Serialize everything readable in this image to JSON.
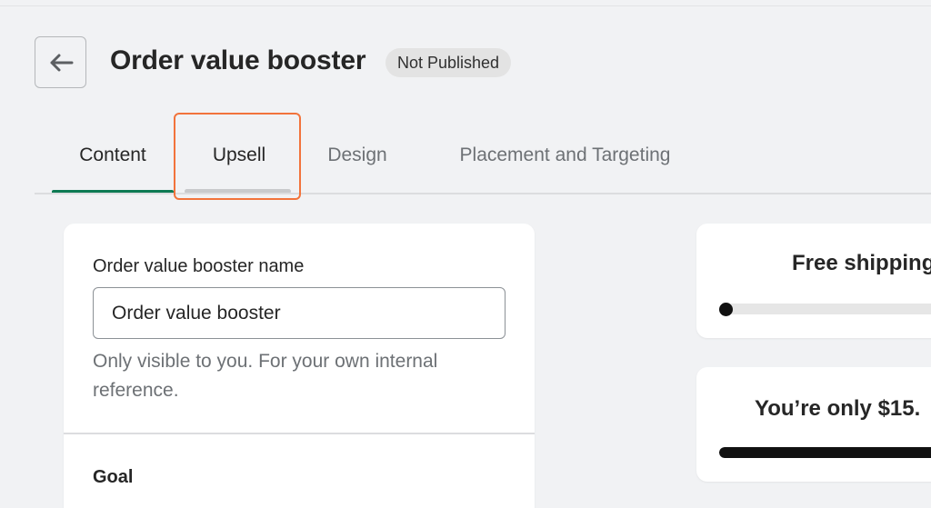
{
  "header": {
    "title": "Order value booster",
    "status_badge": "Not Published"
  },
  "tabs": [
    {
      "label": "Content",
      "active": true
    },
    {
      "label": "Upsell",
      "active": false,
      "highlighted": true
    },
    {
      "label": "Design",
      "active": false
    },
    {
      "label": "Placement and Targeting",
      "active": false
    }
  ],
  "form": {
    "name_label": "Order value booster name",
    "name_value": "Order value booster",
    "name_help": "Only visible to you. For your own internal reference.",
    "goal_title": "Goal"
  },
  "preview": {
    "card1_heading": "Free shipping",
    "card1_progress": 0.0,
    "card2_heading": "You’re only $15.",
    "card2_progress": 1.0
  },
  "colors": {
    "accent_green": "#0e7a53",
    "highlight_orange": "#f2733b",
    "progress_fill": "#111111"
  },
  "icons": {
    "back": "arrow-left-icon"
  }
}
